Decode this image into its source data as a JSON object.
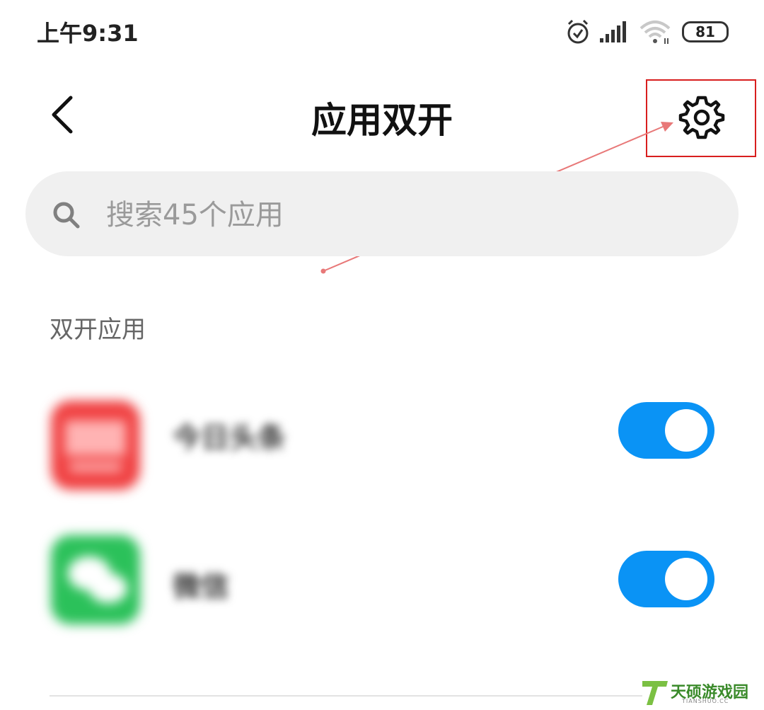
{
  "status_bar": {
    "time": "上午9:31",
    "battery": "81",
    "icons": [
      "alarm-icon",
      "signal-icon",
      "wifi-icon",
      "battery-icon"
    ]
  },
  "nav": {
    "title": "应用双开",
    "back_icon": "back-arrow-icon",
    "settings_icon": "gear-icon"
  },
  "search": {
    "placeholder": "搜索45个应用",
    "value": ""
  },
  "section": {
    "title": "双开应用"
  },
  "apps": [
    {
      "name": "今日头条",
      "icon": "toutiao-app-icon",
      "enabled": true
    },
    {
      "name": "微信",
      "icon": "wechat-app-icon",
      "enabled": true
    }
  ],
  "watermark": {
    "text": "天硕游戏园",
    "sub": "TIANSHUO.CC"
  },
  "colors": {
    "toggle_on": "#0a93f5",
    "highlight": "#d81e1e",
    "annotation_arrow": "#e87878"
  }
}
